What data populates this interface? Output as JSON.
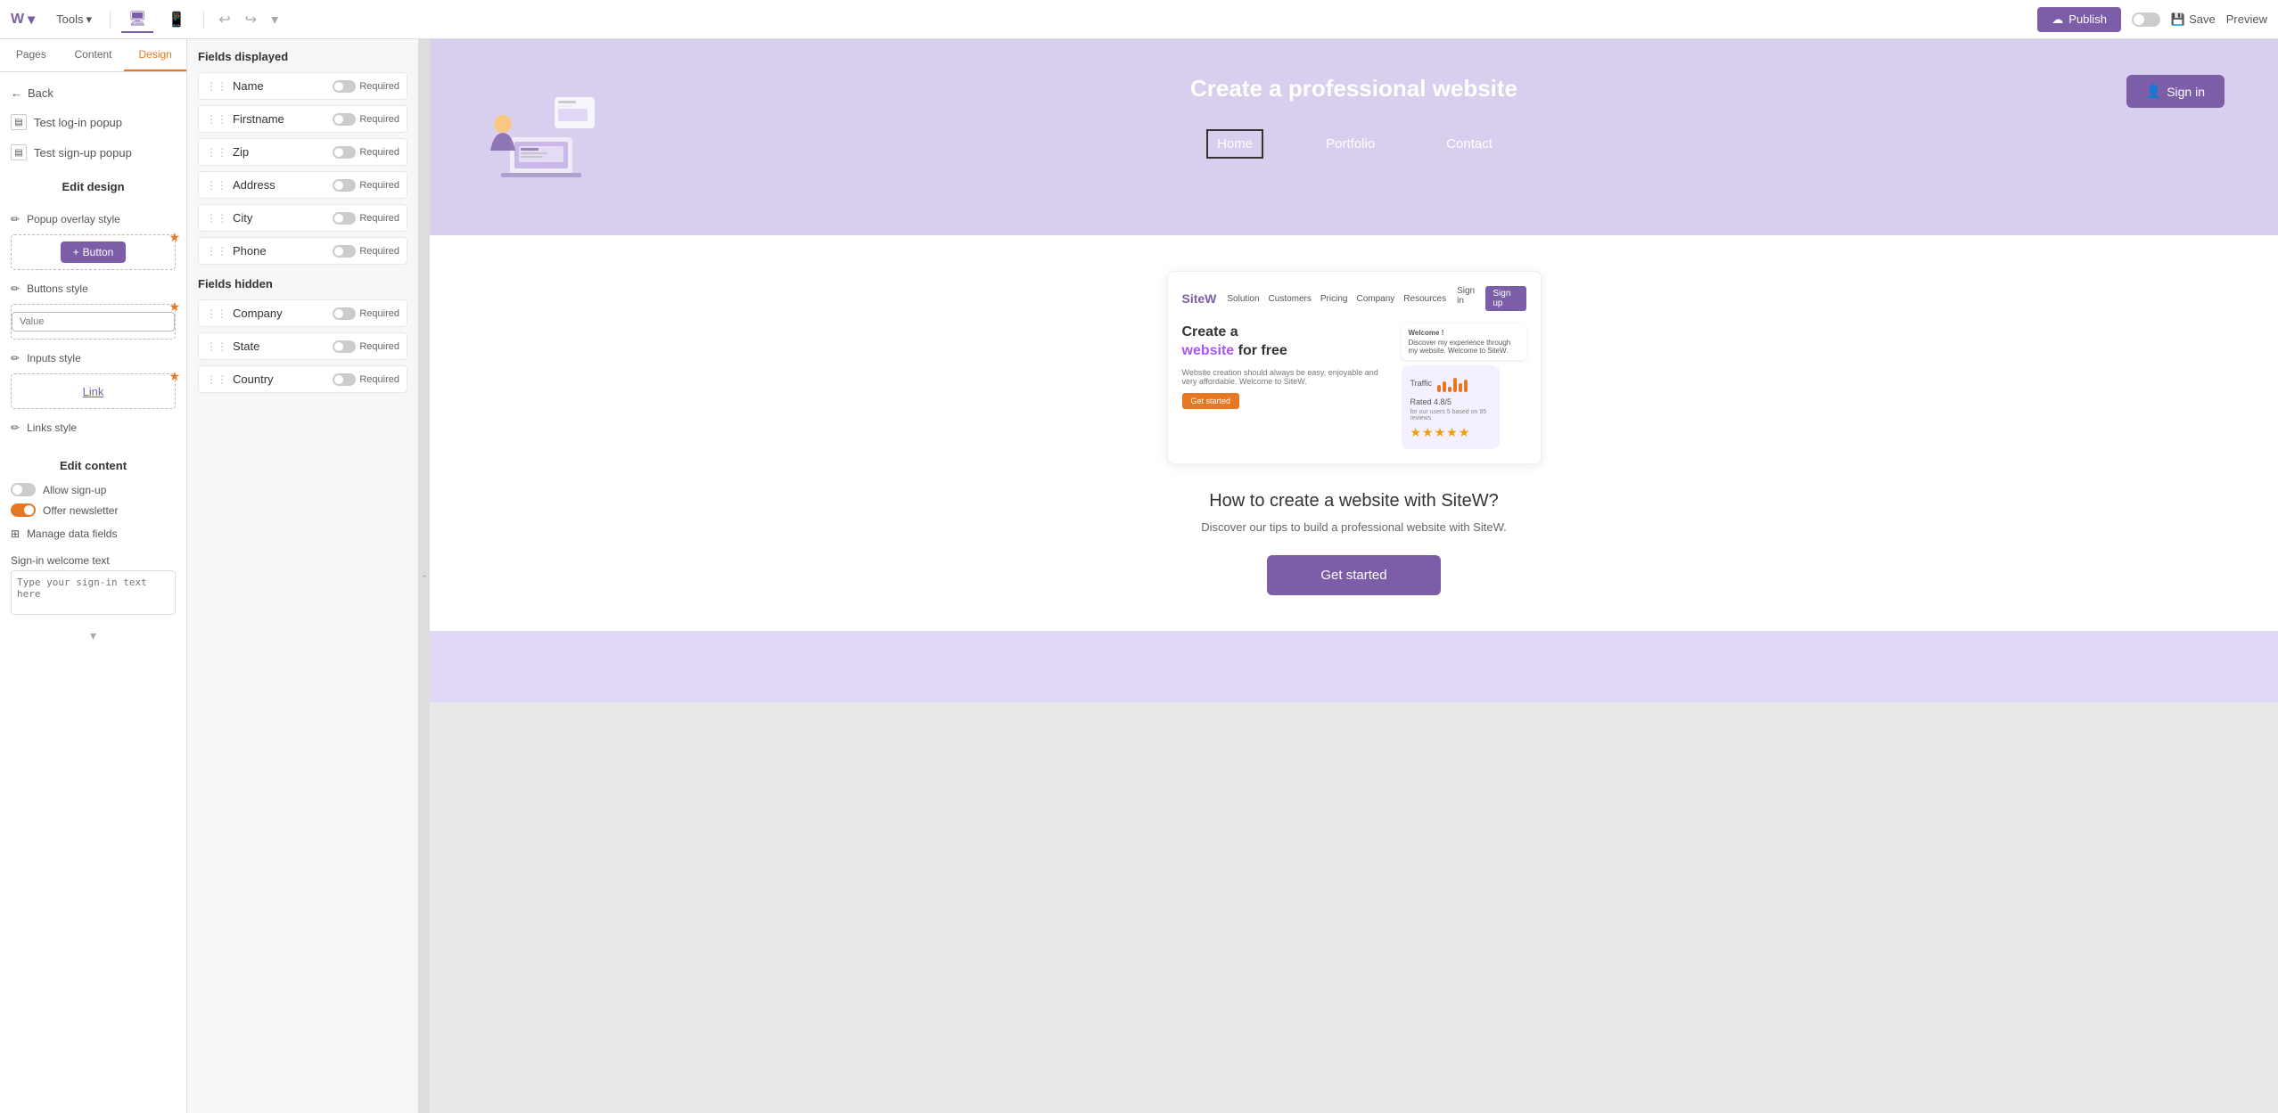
{
  "toolbar": {
    "brand": "W",
    "tools_label": "Tools",
    "tools_arrow": "▾",
    "undo_icon": "↩",
    "redo_icon": "↪",
    "more_icon": "▾",
    "publish_label": "Publish",
    "save_label": "Save",
    "preview_label": "Preview",
    "device_desktop": "🖥",
    "device_mobile": "📱"
  },
  "left_sidebar": {
    "tabs": [
      "Pages",
      "Content",
      "Design"
    ],
    "active_tab": "Design",
    "back_label": "Back",
    "items": [
      {
        "label": "Test log-in popup"
      },
      {
        "label": "Test sign-up popup"
      }
    ],
    "section_title": "Edit design",
    "design_rows": [
      {
        "label": "Popup overlay style"
      },
      {
        "label": "Button"
      },
      {
        "label": "Buttons style"
      },
      {
        "label": "Value"
      },
      {
        "label": "Inputs style"
      },
      {
        "label": "Link"
      },
      {
        "label": "Links style"
      }
    ],
    "edit_content_title": "Edit content",
    "allow_signup_label": "Allow sign-up",
    "offer_newsletter_label": "Offer newsletter",
    "manage_data_label": "Manage data fields",
    "welcome_text_label": "Sign-in welcome text",
    "welcome_text_placeholder": "Type your sign-in text here"
  },
  "middle_panel": {
    "fields_displayed_label": "Fields displayed",
    "fields_displayed": [
      {
        "name": "Name",
        "required_label": "Required"
      },
      {
        "name": "Firstname",
        "required_label": "Required"
      },
      {
        "name": "Zip",
        "required_label": "Required"
      },
      {
        "name": "Address",
        "required_label": "Required"
      },
      {
        "name": "City",
        "required_label": "Required"
      },
      {
        "name": "Phone",
        "required_label": "Required"
      }
    ],
    "fields_hidden_label": "Fields hidden",
    "fields_hidden": [
      {
        "name": "Company",
        "required_label": "Required"
      },
      {
        "name": "State",
        "required_label": "Required"
      },
      {
        "name": "Country",
        "required_label": "Required"
      }
    ]
  },
  "canvas": {
    "hero_title": "Create a professional website",
    "nav_items": [
      "Home",
      "Portfolio",
      "Contact"
    ],
    "nav_active": "Home",
    "sign_in_label": "Sign in",
    "sitew_logo": "SiteW",
    "sitew_nav": [
      "Solution",
      "Customers",
      "Pricing",
      "Company",
      "Resources"
    ],
    "sitew_signin": "Sign in",
    "sitew_signup": "Sign up",
    "sitew_headline_1": "Create a",
    "sitew_headline_2": "website",
    "sitew_headline_3": "for free",
    "sitew_desc": "Website creation should always be easy, enjoyable and very affordable. Welcome to SiteW.",
    "sitew_getstarted": "Get started",
    "sitew_welcome": "Welcome !",
    "sitew_welcome_desc": "Discover my experience through my website. Welcome to SiteW.",
    "sitew_rating": "Rated 4.8/5",
    "sitew_rating_sub": "for our users 5 based on 95 reviews",
    "how_to_title": "How to create a website with SiteW?",
    "how_to_desc": "Discover our tips to build a professional website with SiteW.",
    "get_started_label": "Get started"
  }
}
